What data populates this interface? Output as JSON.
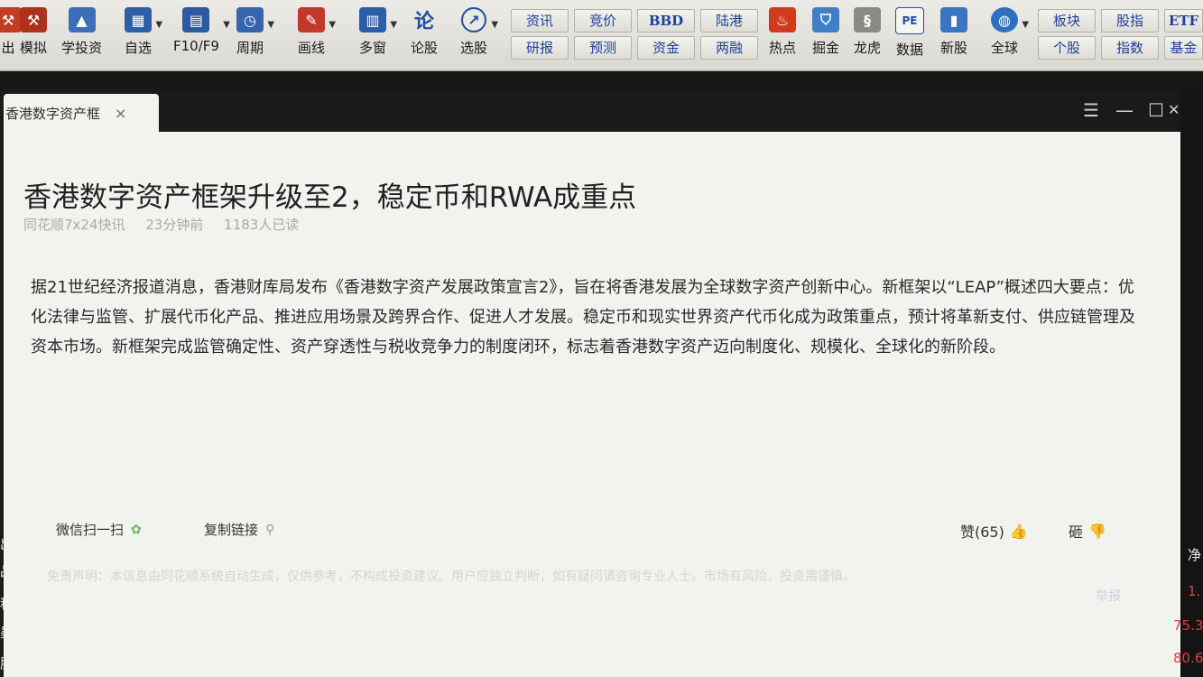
{
  "toolbar": {
    "buttons": [
      {
        "label": "出",
        "icon": "gavel-icon"
      },
      {
        "label": "模拟",
        "icon": "gavel-icon"
      },
      {
        "label": "学投资",
        "icon": "graduation-cap-icon"
      },
      {
        "label": "自选",
        "icon": "calendar-icon"
      },
      {
        "label": "F10/F9",
        "icon": "document-icon"
      },
      {
        "label": "周期",
        "icon": "clock-icon"
      },
      {
        "label": "画线",
        "icon": "pencil-icon"
      },
      {
        "label": "多窗",
        "icon": "multi-window-icon"
      },
      {
        "label": "论股",
        "icon": "discussion-icon",
        "glyph": "论"
      },
      {
        "label": "选股",
        "icon": "magnifier-chart-icon"
      },
      {
        "label": "热点",
        "icon": "hot-flame-icon"
      },
      {
        "label": "掘金",
        "icon": "gold-shield-icon"
      },
      {
        "label": "龙虎",
        "icon": "dragon-icon"
      },
      {
        "label": "数据",
        "icon": "pe-data-icon",
        "glyph": "PE"
      },
      {
        "label": "新股",
        "icon": "new-stock-icon"
      },
      {
        "label": "全球",
        "icon": "globe-icon"
      }
    ],
    "pairs": [
      {
        "top": "资讯",
        "bottom": "研报"
      },
      {
        "top": "竞价",
        "bottom": "预测"
      },
      {
        "top": "BBD",
        "bottom": "资金"
      },
      {
        "top": "陆港",
        "bottom": "两融"
      },
      {
        "top": "板块",
        "bottom": "个股"
      },
      {
        "top": "股指",
        "bottom": "指数"
      },
      {
        "top": "ETF",
        "bottom": "基金"
      }
    ]
  },
  "window": {
    "tab_title": "香港数字资产框",
    "tab_close": "×",
    "controls": {
      "menu": "☰",
      "minimize": "—",
      "maximize": "☐",
      "close": "✕"
    }
  },
  "article": {
    "title": "香港数字资产框架升级至2，稳定币和RWA成重点",
    "source": "同花顺7x24快讯",
    "time": "23分钟前",
    "reads": "1183人已读",
    "paragraph": "据21世纪经济报道消息，香港财库局发布《香港数字资产发展政策宣言2》，旨在将香港发展为全球数字资产创新中心。新框架以“LEAP”概述四大要点：优化法律与监管、扩展代币化产品、推进应用场景及跨界合作、促进人才发展。稳定币和现实世界资产代币化成为政策重点，预计将革新支付、供应链管理及资本市场。新框架完成监管确定性、资产穿透性与税收竞争力的制度闭环，标志着香港数字资产迈向制度化、规模化、全球化的新阶段。",
    "share_wechat": "微信扫一扫",
    "copy_link": "复制链接",
    "like_label": "赞(65)",
    "dislike_label": "砸",
    "disclaimer": "免责声明：本信息由同花顺系统自动生成，仅供参考，不构成投资建议。用户应独立判断，如有疑问请咨询专业人士。市场有风险，投资需谨慎。",
    "disclaimer_link": "举报"
  },
  "right_edge": {
    "labels": [
      "净"
    ],
    "numbers": [
      "1.",
      "75.3",
      "80.6"
    ]
  },
  "left_edge": {
    "letters": [
      "出",
      "品",
      "科",
      "墨",
      "股"
    ]
  }
}
